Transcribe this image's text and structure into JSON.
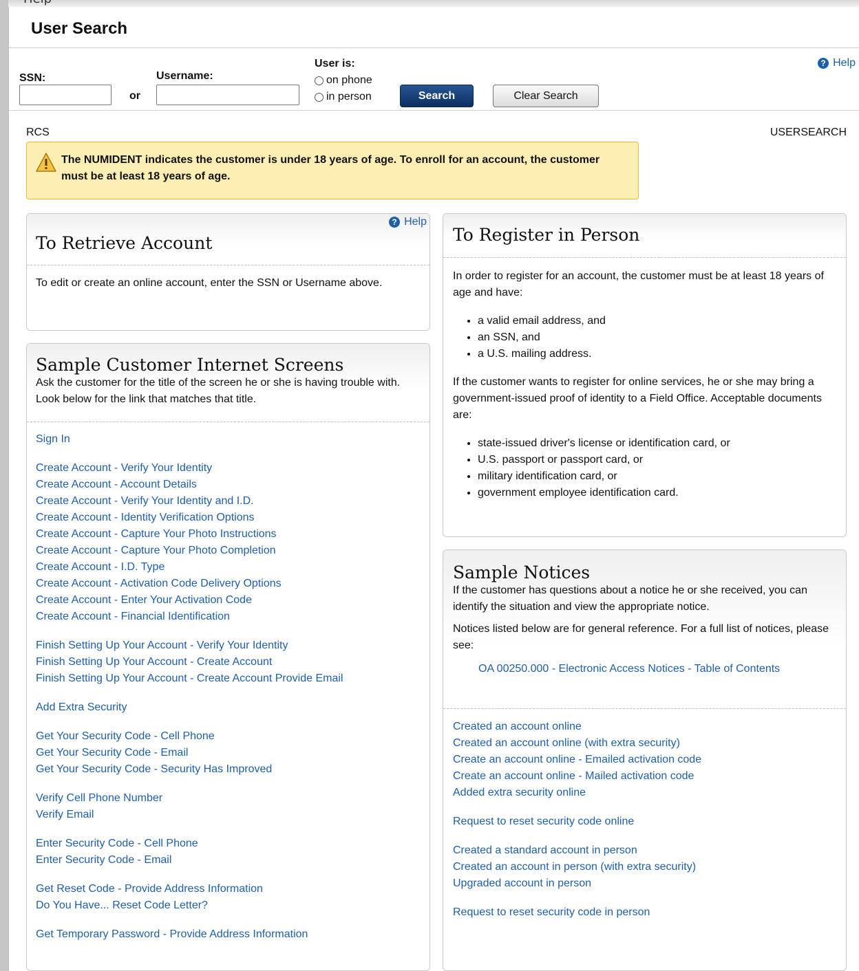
{
  "browser_tab_fragment": "Help",
  "header": {
    "title": "User Search"
  },
  "search": {
    "ssn_label": "SSN:",
    "ssn_value": "",
    "or_label": "or",
    "username_label": "Username:",
    "username_value": "",
    "user_is_label": "User is:",
    "radio_phone_label": "on phone",
    "radio_person_label": "in person",
    "search_button": "Search",
    "clear_button": "Clear Search",
    "help_label": "Help"
  },
  "context": {
    "left_code": "RCS",
    "right_code": "USERSEARCH"
  },
  "alert": {
    "text": "The NUMIDENT indicates the customer is under 18 years of age. To enroll for an account, the customer must be at least 18 years of age.",
    "color": "#fdefb3"
  },
  "retrieve": {
    "help_label": "Help",
    "title": "To Retrieve Account",
    "body": "To edit or create an online account, enter the SSN or Username above."
  },
  "sample_screens": {
    "title": "Sample Customer Internet Screens",
    "subtitle": "Ask the customer for the title of the screen he or she is having trouble with. Look below for the link that matches that title.",
    "groups": [
      [
        "Sign In"
      ],
      [
        "Create Account - Verify Your Identity",
        "Create Account - Account Details",
        "Create Account - Verify Your Identity and I.D.",
        "Create Account - Identity Verification Options",
        "Create Account - Capture Your Photo Instructions",
        "Create Account - Capture Your Photo Completion",
        "Create Account - I.D. Type",
        "Create Account - Activation Code Delivery Options",
        "Create Account - Enter Your Activation Code",
        "Create Account - Financial Identification"
      ],
      [
        "Finish Setting Up Your Account - Verify Your Identity",
        "Finish Setting Up Your Account - Create Account",
        "Finish Setting Up Your Account - Create Account Provide Email"
      ],
      [
        "Add Extra Security"
      ],
      [
        "Get Your Security Code - Cell Phone",
        "Get Your Security Code - Email",
        "Get Your Security Code - Security Has Improved"
      ],
      [
        "Verify Cell Phone Number",
        "Verify Email"
      ],
      [
        "Enter Security Code - Cell Phone",
        "Enter Security Code - Email"
      ],
      [
        "Get Reset Code - Provide Address Information",
        "Do You Have... Reset Code Letter?"
      ],
      [
        "Get Temporary Password - Provide Address Information"
      ]
    ]
  },
  "register": {
    "title": "To Register in Person",
    "intro": "In order to register for an account, the customer must be at least 18 years of age and have:",
    "requirements": [
      "a valid email address, and",
      "an SSN, and",
      "a U.S. mailing address."
    ],
    "para2": "If the customer wants to register for online services, he or she may bring a government-issued proof of identity to a Field Office. Acceptable documents are:",
    "documents": [
      "state-issued driver's license or identification card, or",
      "U.S. passport or passport card, or",
      "military identification card, or",
      "government employee identification card."
    ]
  },
  "notices": {
    "title": "Sample Notices",
    "subtitle": "If the customer has questions about a notice he or she received, you can identify the situation and view the appropriate notice.",
    "para2": "Notices listed below are for general reference. For a full list of notices, please see:",
    "toc_link": "OA 00250.000 - Electronic Access Notices - Table of Contents",
    "groups": [
      [
        "Created an account online",
        "Created an account online (with extra security)",
        "Create an account online - Emailed activation code",
        "Create an account online - Mailed activation code",
        "Added extra security online"
      ],
      [
        "Request to reset security code online"
      ],
      [
        "Created a standard account in person",
        "Created an account in person (with extra security)",
        "Upgraded account in person"
      ],
      [
        "Request to reset security code in person"
      ]
    ]
  },
  "colors": {
    "link": "#1f5fa8",
    "button_primary": "#0c2f63",
    "alert_border": "#e7b93a"
  }
}
